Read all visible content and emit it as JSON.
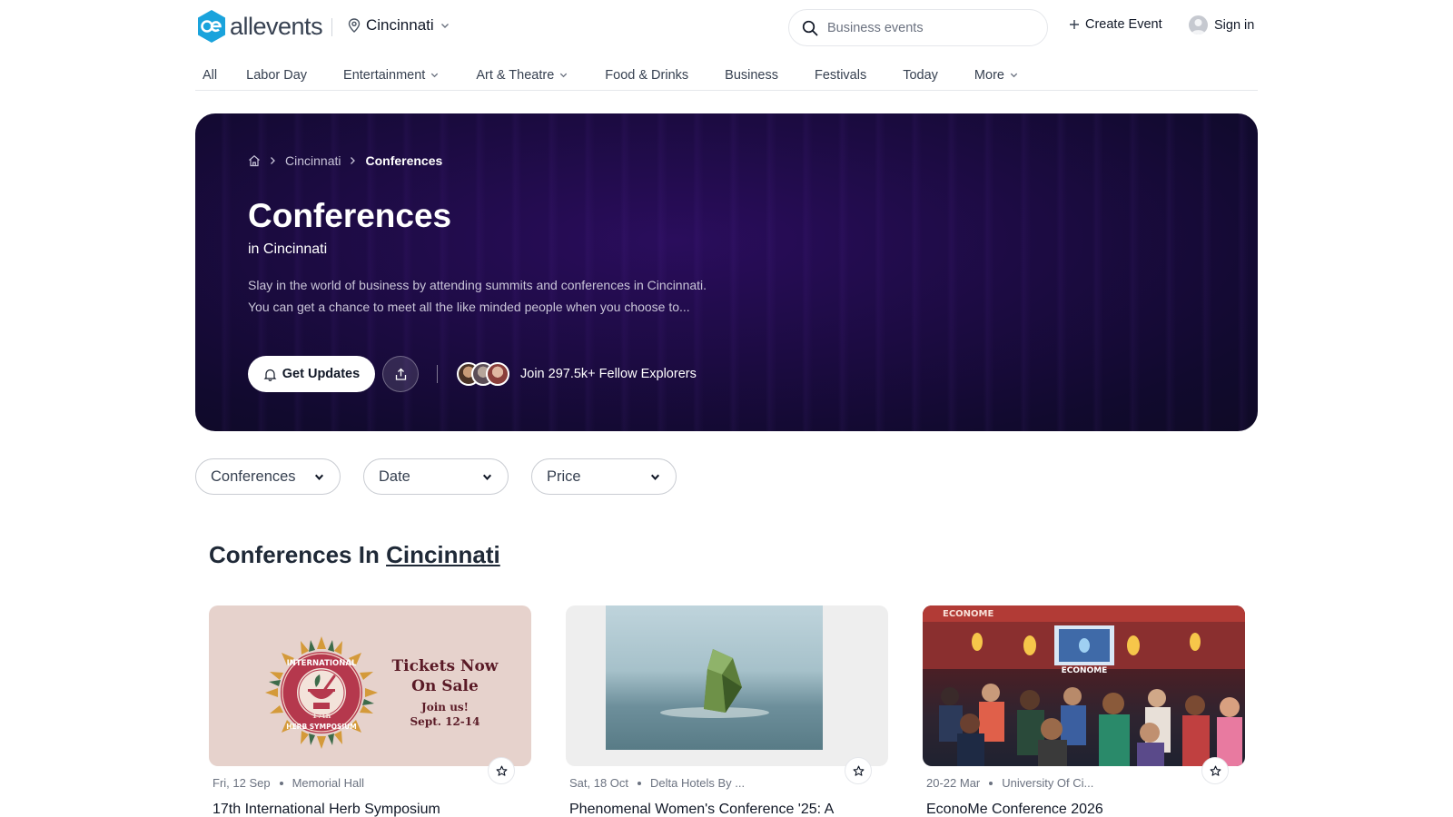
{
  "header": {
    "logo_text": "allevents",
    "city": "Cincinnati",
    "search_placeholder": "Business events",
    "create_event": "Create Event",
    "sign_in": "Sign in"
  },
  "nav": {
    "items": [
      {
        "label": "All",
        "dropdown": false
      },
      {
        "label": "Labor Day",
        "dropdown": false
      },
      {
        "label": "Entertainment",
        "dropdown": true
      },
      {
        "label": "Art & Theatre",
        "dropdown": true
      },
      {
        "label": "Food & Drinks",
        "dropdown": false
      },
      {
        "label": "Business",
        "dropdown": false
      },
      {
        "label": "Festivals",
        "dropdown": false
      },
      {
        "label": "Today",
        "dropdown": false
      },
      {
        "label": "More",
        "dropdown": true
      }
    ]
  },
  "hero": {
    "breadcrumb": {
      "city": "Cincinnati",
      "current": "Conferences"
    },
    "title": "Conferences",
    "subtitle": "in Cincinnati",
    "description_line1": "Slay in the world of business by attending summits and conferences in Cincinnati.",
    "description_line2": "You can get a chance to meet all the like minded people when you choose to...",
    "get_updates": "Get Updates",
    "join_text": "Join 297.5k+ Fellow Explorers"
  },
  "filters": {
    "category": "Conferences",
    "date": "Date",
    "price": "Price"
  },
  "section": {
    "title_prefix": "Conferences In",
    "title_city": "Cincinnati"
  },
  "cards": [
    {
      "date": "Fri, 12 Sep",
      "venue": "Memorial Hall",
      "title": "17th International Herb Symposium",
      "image_text": {
        "line1": "Tickets Now",
        "line2": "On Sale",
        "line3": "Join us!",
        "line4": "Sept. 12-14",
        "seal_top": "INTERNATIONAL",
        "seal_mid": "17th",
        "seal_bottom": "HERB SYMPOSIUM"
      }
    },
    {
      "date": "Sat, 18 Oct",
      "venue": "Delta Hotels By ...",
      "title": "Phenomenal Women's Conference '25: A"
    },
    {
      "date": "20-22 Mar",
      "venue": "University Of Ci...",
      "title": "EconoMe Conference 2026",
      "image_text": {
        "banner": "ECONOME",
        "stage": "ECONOME"
      }
    }
  ],
  "colors": {
    "brand": "#1aa3dc",
    "hero_bg": "#1c0b42"
  }
}
